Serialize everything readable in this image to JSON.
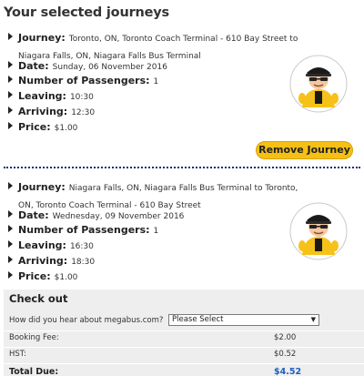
{
  "page": {
    "title": "Your selected journeys"
  },
  "journeys": [
    {
      "journey_label": "Journey:",
      "journey_value": "Toronto, ON, Toronto Coach Terminal - 610 Bay Street to Niagara Falls, ON, Niagara Falls Bus Terminal",
      "date_label": "Date:",
      "date_value": "Sunday, 06 November 2016",
      "passengers_label": "Number of Passengers:",
      "passengers_value": "1",
      "leaving_label": "Leaving:",
      "leaving_value": "10:30",
      "arriving_label": "Arriving:",
      "arriving_value": "12:30",
      "price_label": "Price:",
      "price_value": "$1.00",
      "remove_label": "Remove Journey"
    },
    {
      "journey_label": "Journey:",
      "journey_value": "Niagara Falls, ON, Niagara Falls Bus Terminal to Toronto, ON, Toronto Coach Terminal - 610 Bay Street",
      "date_label": "Date:",
      "date_value": "Wednesday, 09 November 2016",
      "passengers_label": "Number of Passengers:",
      "passengers_value": "1",
      "leaving_label": "Leaving:",
      "leaving_value": "16:30",
      "arriving_label": "Arriving:",
      "arriving_value": "18:30",
      "price_label": "Price:",
      "price_value": "$1.00"
    }
  ],
  "mascot": {
    "icon": "bus-driver-mascot-icon"
  },
  "checkout": {
    "title": "Check out",
    "hear_label": "How did you hear about megabus.com?",
    "hear_select_value": "Please Select",
    "booking_fee_label": "Booking Fee:",
    "booking_fee_value": "$2.00",
    "hst_label": "HST:",
    "hst_value": "$0.52",
    "total_label": "Total Due:",
    "total_value": "$4.52"
  },
  "colors": {
    "accent": "#f5c016",
    "total": "#1f5fbf",
    "separator": "#1e2a78",
    "panel": "#eeeeee"
  }
}
